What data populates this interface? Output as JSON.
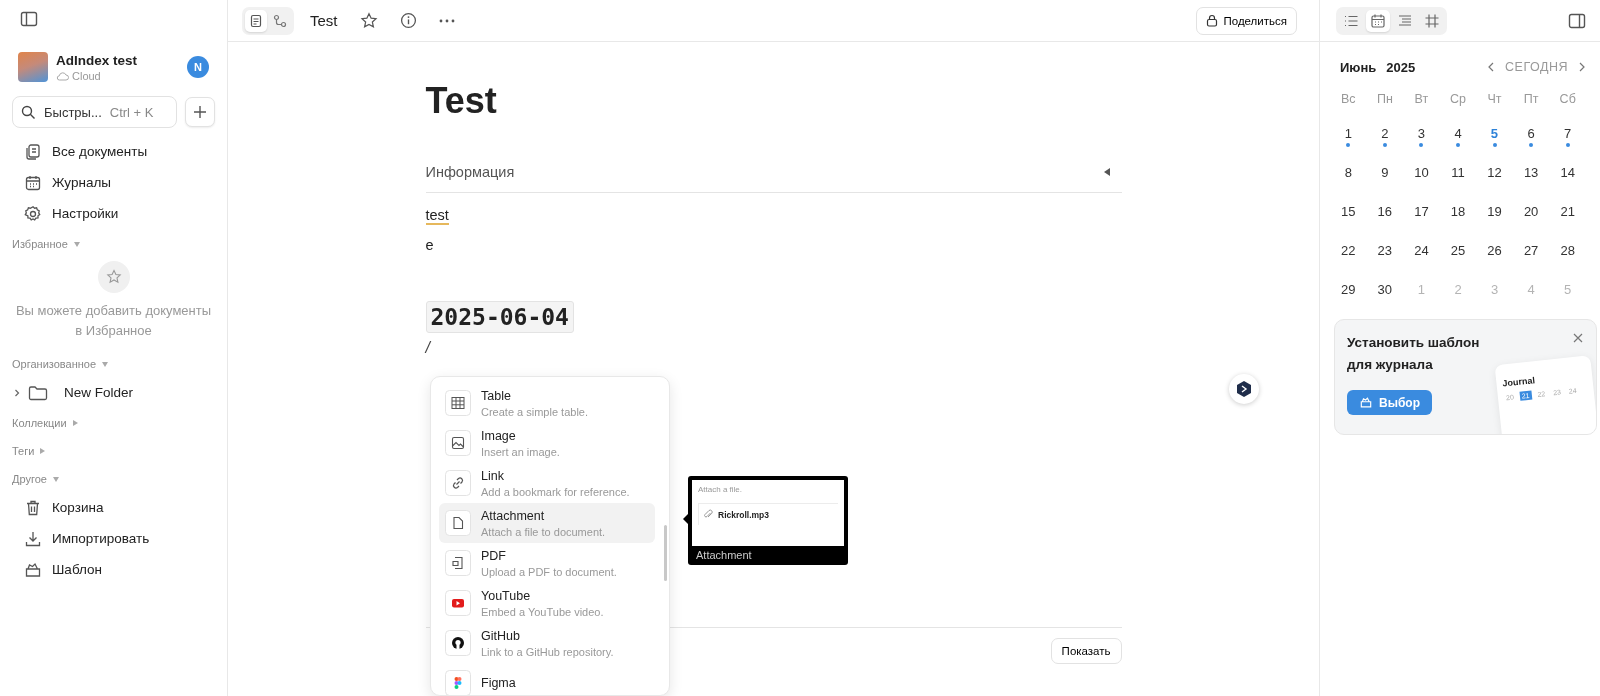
{
  "sidebar": {
    "workspace": {
      "name": "AdIndex test",
      "subtitle": "Cloud",
      "avatar": "N"
    },
    "search": {
      "placeholder": "Быстры...",
      "shortcut": "Ctrl + K"
    },
    "nav": [
      {
        "label": "Все документы",
        "kind": "docs"
      },
      {
        "label": "Журналы",
        "kind": "calendar"
      },
      {
        "label": "Настройки",
        "kind": "settings"
      }
    ],
    "favorites": {
      "title": "Избранное",
      "empty_text": "Вы можете добавить документы в Избранное"
    },
    "organized": {
      "title": "Организованное",
      "items": [
        {
          "label": "New Folder",
          "expanded": false
        }
      ]
    },
    "collections": {
      "title": "Коллекции"
    },
    "tags": {
      "title": "Теги"
    },
    "other": {
      "title": "Другое",
      "items": [
        {
          "label": "Корзина",
          "kind": "trash"
        },
        {
          "label": "Импортировать",
          "kind": "import"
        },
        {
          "label": "Шаблон",
          "kind": "template"
        }
      ]
    }
  },
  "topbar": {
    "modes": [
      {
        "kind": "page",
        "selected": true
      },
      {
        "kind": "edgeless",
        "selected": false
      }
    ],
    "title": "Test",
    "share": "Поделиться"
  },
  "document": {
    "title": "Test",
    "info_label": "Информация",
    "lines": [
      "test",
      "e"
    ],
    "date": "2025-06-04",
    "slash": "/",
    "show_button": "Показать"
  },
  "slash_menu": [
    {
      "kind": "table",
      "title": "Table",
      "desc": "Create a simple table.",
      "selected": false
    },
    {
      "kind": "image",
      "title": "Image",
      "desc": "Insert an image.",
      "selected": false
    },
    {
      "kind": "link",
      "title": "Link",
      "desc": "Add a bookmark for reference.",
      "selected": false
    },
    {
      "kind": "attachment",
      "title": "Attachment",
      "desc": "Attach a file to document.",
      "selected": true
    },
    {
      "kind": "pdf",
      "title": "PDF",
      "desc": "Upload a PDF to document.",
      "selected": false
    },
    {
      "kind": "youtube",
      "title": "YouTube",
      "desc": "Embed a YouTube video.",
      "selected": false
    },
    {
      "kind": "github",
      "title": "GitHub",
      "desc": "Link to a GitHub repository.",
      "selected": false
    },
    {
      "kind": "figma",
      "title": "Figma",
      "selected": false
    }
  ],
  "preview": {
    "hint": "Attach a file.",
    "file": "Rickroll.mp3",
    "caption": "Attachment"
  },
  "right_panel": {
    "tabs": [
      {
        "kind": "outline",
        "selected": false
      },
      {
        "kind": "journal",
        "selected": true
      },
      {
        "kind": "toc",
        "selected": false
      },
      {
        "kind": "frame",
        "selected": false
      }
    ],
    "calendar": {
      "month": "Июнь",
      "year": "2025",
      "today_button": "СЕГОДНЯ",
      "weekdays": [
        "Вс",
        "Пн",
        "Вт",
        "Ср",
        "Чт",
        "Пт",
        "Сб"
      ],
      "weeks": [
        [
          {
            "label": "1",
            "current_month": true,
            "today": false,
            "has_entry": true
          },
          {
            "label": "2",
            "current_month": true,
            "today": false,
            "has_entry": true
          },
          {
            "label": "3",
            "current_month": true,
            "today": false,
            "has_entry": true
          },
          {
            "label": "4",
            "current_month": true,
            "today": false,
            "has_entry": true
          },
          {
            "label": "5",
            "current_month": true,
            "today": true,
            "has_entry": true
          },
          {
            "label": "6",
            "current_month": true,
            "today": false,
            "has_entry": true
          },
          {
            "label": "7",
            "current_month": true,
            "today": false,
            "has_entry": true
          }
        ],
        [
          {
            "label": "8",
            "current_month": true,
            "today": false,
            "has_entry": false
          },
          {
            "label": "9",
            "current_month": true,
            "today": false,
            "has_entry": false
          },
          {
            "label": "10",
            "current_month": true,
            "today": false,
            "has_entry": false
          },
          {
            "label": "11",
            "current_month": true,
            "today": false,
            "has_entry": false
          },
          {
            "label": "12",
            "current_month": true,
            "today": false,
            "has_entry": false
          },
          {
            "label": "13",
            "current_month": true,
            "today": false,
            "has_entry": false
          },
          {
            "label": "14",
            "current_month": true,
            "today": false,
            "has_entry": false
          }
        ],
        [
          {
            "label": "15",
            "current_month": true,
            "today": false,
            "has_entry": false
          },
          {
            "label": "16",
            "current_month": true,
            "today": false,
            "has_entry": false
          },
          {
            "label": "17",
            "current_month": true,
            "today": false,
            "has_entry": false
          },
          {
            "label": "18",
            "current_month": true,
            "today": false,
            "has_entry": false
          },
          {
            "label": "19",
            "current_month": true,
            "today": false,
            "has_entry": false
          },
          {
            "label": "20",
            "current_month": true,
            "today": false,
            "has_entry": false
          },
          {
            "label": "21",
            "current_month": true,
            "today": false,
            "has_entry": false
          }
        ],
        [
          {
            "label": "22",
            "current_month": true,
            "today": false,
            "has_entry": false
          },
          {
            "label": "23",
            "current_month": true,
            "today": false,
            "has_entry": false
          },
          {
            "label": "24",
            "current_month": true,
            "today": false,
            "has_entry": false
          },
          {
            "label": "25",
            "current_month": true,
            "today": false,
            "has_entry": false
          },
          {
            "label": "26",
            "current_month": true,
            "today": false,
            "has_entry": false
          },
          {
            "label": "27",
            "current_month": true,
            "today": false,
            "has_entry": false
          },
          {
            "label": "28",
            "current_month": true,
            "today": false,
            "has_entry": false
          }
        ],
        [
          {
            "label": "29",
            "current_month": true,
            "today": false,
            "has_entry": false
          },
          {
            "label": "30",
            "current_month": true,
            "today": false,
            "has_entry": false
          },
          {
            "label": "1",
            "current_month": false,
            "today": false,
            "has_entry": false
          },
          {
            "label": "2",
            "current_month": false,
            "today": false,
            "has_entry": false
          },
          {
            "label": "3",
            "current_month": false,
            "today": false,
            "has_entry": false
          },
          {
            "label": "4",
            "current_month": false,
            "today": false,
            "has_entry": false
          },
          {
            "label": "5",
            "current_month": false,
            "today": false,
            "has_entry": false
          }
        ]
      ]
    },
    "template_card": {
      "title": "Установить шаблон для журнала",
      "button": "Выбор",
      "illustration": {
        "title": "Journal",
        "days": [
          {
            "label": "20",
            "selected": false
          },
          {
            "label": "21",
            "selected": true
          },
          {
            "label": "22",
            "selected": false
          },
          {
            "label": "23",
            "selected": false
          },
          {
            "label": "24",
            "selected": false
          }
        ]
      }
    }
  }
}
